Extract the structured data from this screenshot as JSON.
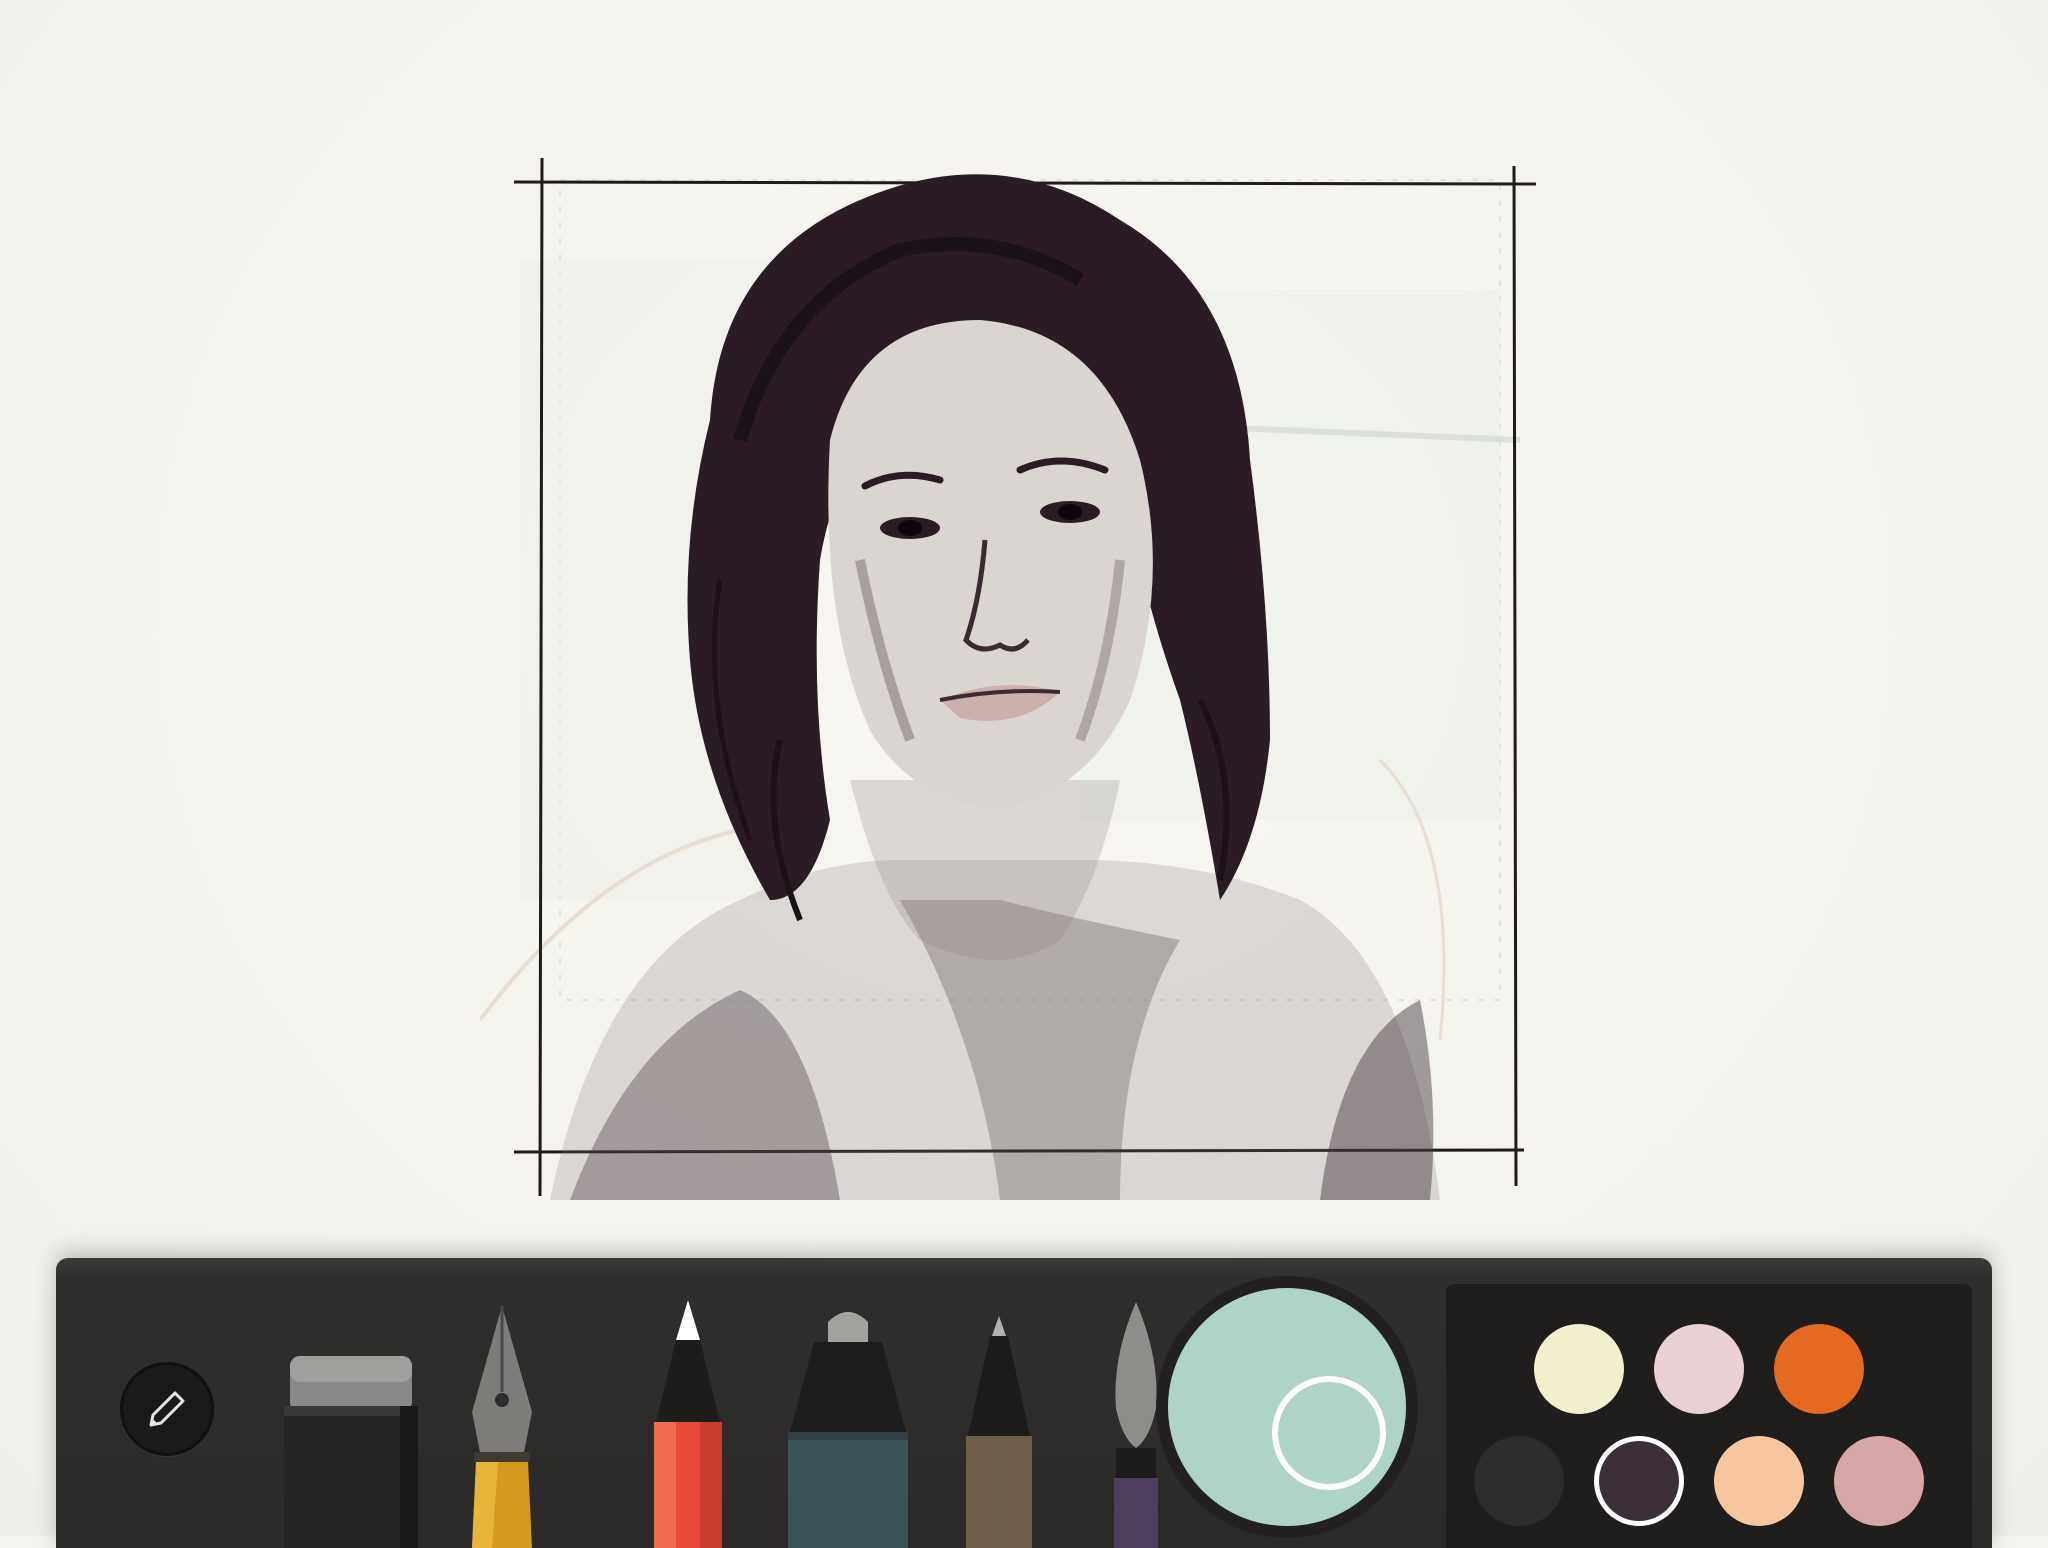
{
  "app": {
    "canvas_background": "#f4f3ee"
  },
  "sketch": {
    "stroke_color": "#2b1d24",
    "description_icon": "portrait-sketch"
  },
  "toolbar": {
    "mode_icon": "pencil-icon",
    "tools": [
      {
        "id": "eraser",
        "icon": "eraser-icon"
      },
      {
        "id": "fountain-pen",
        "icon": "fountain-pen-icon"
      },
      {
        "id": "pencil",
        "icon": "pencil-icon",
        "selected": true
      },
      {
        "id": "marker",
        "icon": "marker-icon"
      },
      {
        "id": "fineliner",
        "icon": "fineliner-icon"
      },
      {
        "id": "brush",
        "icon": "brush-icon"
      }
    ],
    "mixer_color": "#aed4c8",
    "palette": [
      {
        "color": "#f1efcc",
        "selected": false
      },
      {
        "color": "#e9d1d3",
        "selected": false
      },
      {
        "color": "#e56a21",
        "selected": false
      },
      {
        "color": "#2e2c2b",
        "selected": false
      },
      {
        "color": "#3d2f37",
        "selected": true
      },
      {
        "color": "#f6c79f",
        "selected": false
      },
      {
        "color": "#d5a7a5",
        "selected": false
      }
    ]
  }
}
